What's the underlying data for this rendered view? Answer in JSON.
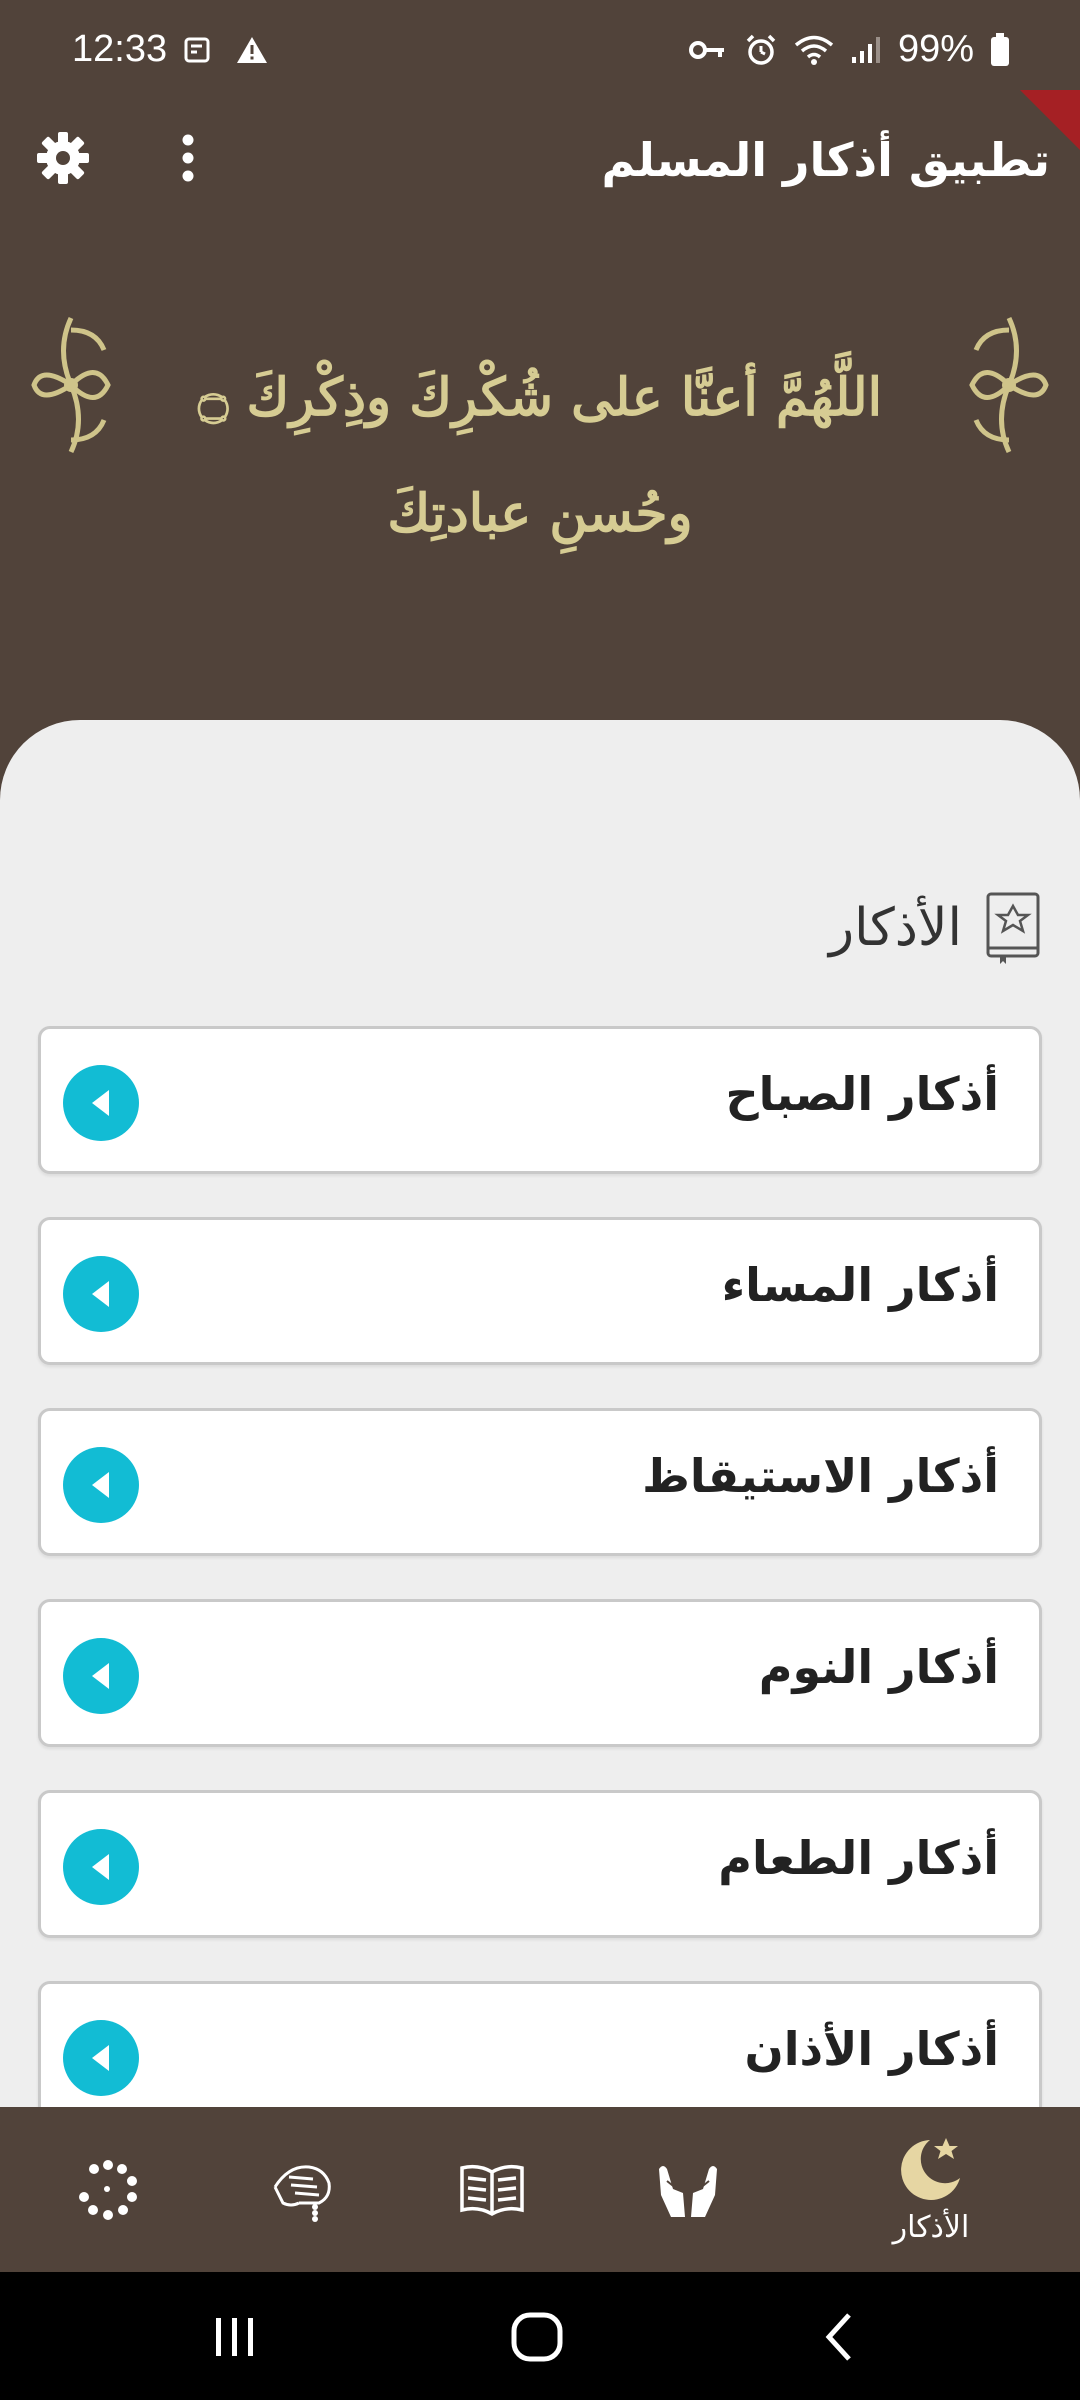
{
  "status": {
    "time": "12:33",
    "battery": "99%"
  },
  "appbar": {
    "title": "تطبيق أذكار المسلم"
  },
  "header": {
    "dua": "اللَّهُمَّ أعنَّا على شُكْرِكَ وذِكْرِكَ ۝ وحُسنِ عبادتِكَ"
  },
  "section": {
    "title": "الأذكار",
    "items": [
      {
        "label": "أذكار الصباح"
      },
      {
        "label": "أذكار المساء"
      },
      {
        "label": "أذكار الاستيقاظ"
      },
      {
        "label": "أذكار النوم"
      },
      {
        "label": "أذكار الطعام"
      },
      {
        "label": "أذكار الأذان"
      }
    ]
  },
  "bottom_nav": {
    "items": [
      {
        "icon": "tasbih-beads-icon"
      },
      {
        "icon": "hand-rosary-icon"
      },
      {
        "icon": "open-book-icon"
      },
      {
        "icon": "praying-hands-icon"
      },
      {
        "icon": "crescent-star-icon",
        "label": "الأذكار",
        "active": true
      }
    ]
  },
  "colors": {
    "brown": "#51433a",
    "gold": "#d6cc93",
    "accent": "#12bcd4",
    "sheet": "#eeeeee"
  }
}
